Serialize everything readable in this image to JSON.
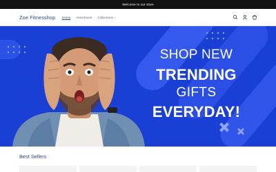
{
  "announcement": {
    "text": "Welcome to our store"
  },
  "header": {
    "brand": "Zoe Fitnesshop",
    "nav": [
      {
        "label": "Home",
        "active": true
      },
      {
        "label": "Assortment",
        "active": false
      },
      {
        "label": "Collections",
        "active": false,
        "has_dropdown": true
      }
    ],
    "icons": [
      "search-icon",
      "account-icon",
      "cart-icon"
    ]
  },
  "hero": {
    "lines": [
      "SHOP NEW",
      "TRENDING",
      "GIFTS",
      "EVERYDAY!"
    ],
    "background_color": "#1a3fd4"
  },
  "best_sellers": {
    "title": "Best Sellers",
    "product_count": 4
  },
  "colors": {
    "announcement_bg": "#121212",
    "brand": "#2d4a8a",
    "hero_bg": "#1a3fd4",
    "card_bg": "#f3f3f3"
  }
}
